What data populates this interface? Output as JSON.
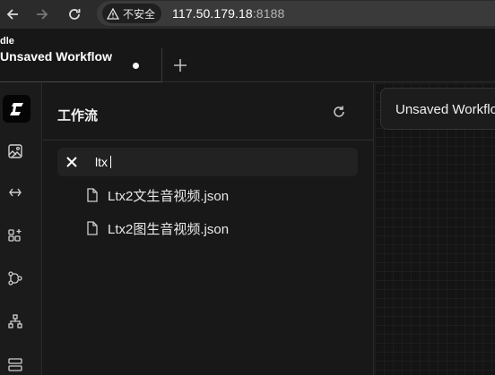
{
  "browser": {
    "security_label": "不安全",
    "url_host": "117.50.179.18",
    "url_port": ":8188"
  },
  "app": {
    "name_fragment": "dle"
  },
  "tabs": [
    {
      "title": "Unsaved Workflow",
      "modified": true
    }
  ],
  "sidebar": {
    "items": [
      {
        "icon": "logo-icon"
      },
      {
        "icon": "image-icon"
      },
      {
        "icon": "model-icon"
      },
      {
        "icon": "node-library-icon"
      },
      {
        "icon": "workflow-icon"
      },
      {
        "icon": "templates-icon"
      },
      {
        "icon": "queue-icon"
      }
    ]
  },
  "panel": {
    "title": "工作流",
    "search_value": "ltx",
    "files": [
      {
        "name": "Ltx2文生音视频.json"
      },
      {
        "name": "Ltx2图生音视频.json"
      }
    ]
  },
  "canvas": {
    "workflow_title": "Unsaved Workflow"
  }
}
